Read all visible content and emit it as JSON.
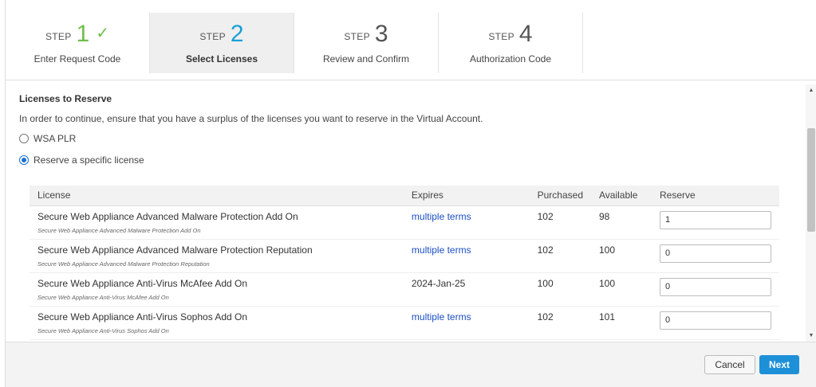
{
  "steps": [
    {
      "word": "STEP",
      "number": "1",
      "label": "Enter Request Code",
      "state": "done"
    },
    {
      "word": "STEP",
      "number": "2",
      "label": "Select Licenses",
      "state": "current"
    },
    {
      "word": "STEP",
      "number": "3",
      "label": "Review and Confirm",
      "state": "pending"
    },
    {
      "word": "STEP",
      "number": "4",
      "label": "Authorization Code",
      "state": "pending"
    }
  ],
  "check_glyph": "✓",
  "section": {
    "title": "Licenses to Reserve",
    "instructions": "In order to continue, ensure that you have a surplus of the licenses you want to reserve in the Virtual Account."
  },
  "options": [
    {
      "label": "WSA PLR",
      "selected": false
    },
    {
      "label": "Reserve a specific license",
      "selected": true
    }
  ],
  "table": {
    "headers": {
      "license": "License",
      "expires": "Expires",
      "purchased": "Purchased",
      "available": "Available",
      "reserve": "Reserve"
    },
    "rows": [
      {
        "name": "Secure Web Appliance Advanced Malware Protection Add On",
        "sub": "Secure Web Appliance Advanced Malware Protection Add On",
        "expires": "multiple terms",
        "expires_link": true,
        "purchased": "102",
        "available": "98",
        "reserve": "1"
      },
      {
        "name": "Secure Web Appliance Advanced Malware Protection Reputation",
        "sub": "Secure Web Appliance Advanced Malware Protection Reputation",
        "expires": "multiple terms",
        "expires_link": true,
        "purchased": "102",
        "available": "100",
        "reserve": "0"
      },
      {
        "name": "Secure Web Appliance Anti-Virus McAfee Add On",
        "sub": "Secure Web Appliance Anti-Virus McAfee Add On",
        "expires": "2024-Jan-25",
        "expires_link": false,
        "purchased": "100",
        "available": "100",
        "reserve": "0"
      },
      {
        "name": "Secure Web Appliance Anti-Virus Sophos Add On",
        "sub": "Secure Web Appliance Anti-Virus Sophos Add On",
        "expires": "multiple terms",
        "expires_link": true,
        "purchased": "102",
        "available": "101",
        "reserve": "0"
      }
    ]
  },
  "footer": {
    "cancel_label": "Cancel",
    "next_label": "Next"
  },
  "colors": {
    "done": "#6ebe4a",
    "current": "#1ba0d7",
    "link": "#1b4fc4",
    "primary": "#1e90d8"
  }
}
